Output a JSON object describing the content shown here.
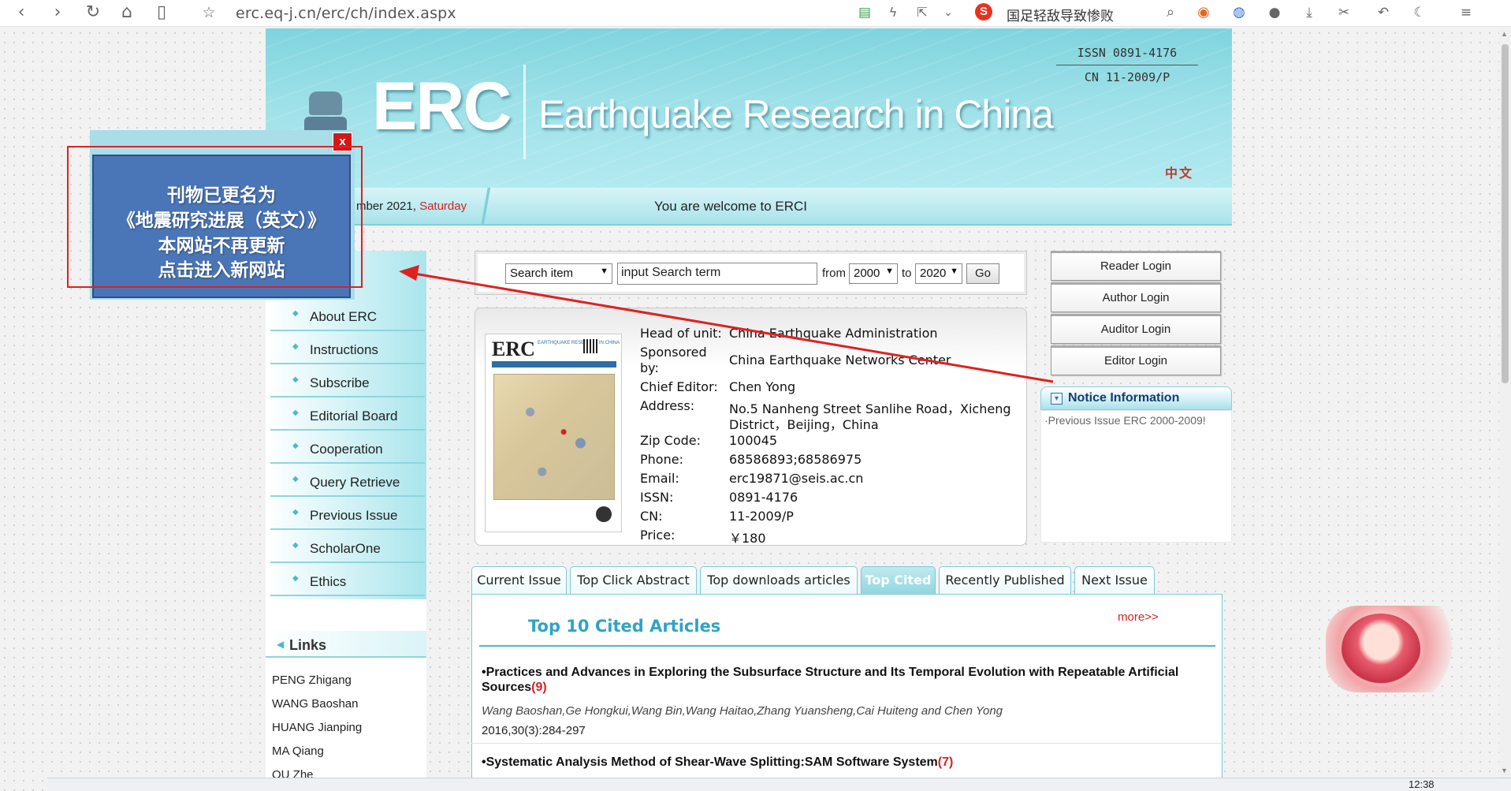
{
  "browser": {
    "url": "erc.eq-j.cn/erc/ch/index.aspx",
    "search_suggestion": "国足轻敌导致惨败",
    "nav_icons": [
      "back-icon",
      "forward-icon",
      "reload-icon",
      "home-icon",
      "reader-icon",
      "star-icon"
    ]
  },
  "header": {
    "logo": "ERC",
    "title": "Earthquake Research in China",
    "issn": "ISSN 0891-4176",
    "cn": "CN 11-2009/P",
    "lang_link": "中文"
  },
  "strip": {
    "date_text": "mber  2021,",
    "day": "Saturday",
    "welcome": "You are welcome to ERCI"
  },
  "popup": {
    "close": "x",
    "lines": [
      "刊物已更名为",
      "《地震研究进展（英文）》",
      "本网站不再更新",
      "点击进入新网站"
    ]
  },
  "search": {
    "field_select": "Search item",
    "input_value": "input Search term",
    "from_label": "from",
    "from_year": "2000",
    "to_label": "to",
    "to_year": "2020",
    "go_label": "Go"
  },
  "nav": {
    "items": [
      "About ERC",
      "Instructions",
      "Subscribe",
      "Editorial Board",
      "Cooperation",
      "Query Retrieve",
      "Previous Issue",
      "ScholarOne",
      "Ethics"
    ],
    "links_title": "Links",
    "links": [
      "PENG Zhigang",
      "WANG Baoshan",
      "HUANG Jianping",
      "MA Qiang",
      "QU Zhe"
    ]
  },
  "journal": {
    "cover_logo": "ERC",
    "cover_subtitle": "EARTHQUAKE RESEARCH IN CHINA",
    "rows": [
      {
        "label": "Head of unit:",
        "value": "China Earthquake Administration"
      },
      {
        "label": "Sponsored",
        "value": "China Earthquake Networks Center"
      },
      {
        "label": "by:",
        "value": ""
      },
      {
        "label": "Chief Editor:",
        "value": "Chen Yong"
      },
      {
        "label": "Address:",
        "value": "No.5 Nanheng Street Sanlihe Road，Xicheng"
      },
      {
        "label": "",
        "value": "District，Beijing，China"
      },
      {
        "label": "Zip Code:",
        "value": "100045"
      },
      {
        "label": "Phone:",
        "value": "68586893;68586975"
      },
      {
        "label": "Email:",
        "value": "erc19871@seis.ac.cn"
      },
      {
        "label": "ISSN:",
        "value": "0891-4176"
      },
      {
        "label": "CN:",
        "value": "11-2009/P"
      },
      {
        "label": "Price:",
        "value": "￥180"
      }
    ]
  },
  "logins": [
    "Reader Login",
    "Author Login",
    "Auditor Login",
    "Editor Login"
  ],
  "notice": {
    "title": "Notice Information",
    "items": [
      "·Previous Issue ERC 2000-2009!"
    ]
  },
  "tabs": [
    "Current Issue",
    "Top Click Abstract",
    "Top downloads articles",
    "Top Cited",
    "Recently Published",
    "Next Issue"
  ],
  "top_cited": {
    "more": "more>>",
    "title": "Top 10 Cited Articles",
    "articles": [
      {
        "title": "•Practices and Advances in Exploring the Subsurface Structure and Its Temporal Evolution with Repeatable Artificial Sources",
        "count": "(9)",
        "authors": "Wang Baoshan,Ge Hongkui,Wang Bin,Wang Haitao,Zhang Yuansheng,Cai Huiteng and Chen Yong",
        "cite": "2016,30(3):284-297"
      },
      {
        "title": "•Systematic Analysis Method of Shear-Wave Splitting:SAM Software System",
        "count": "(7)"
      }
    ]
  },
  "taskbar": {
    "clock": "12:38"
  },
  "colors": {
    "accent": "#2ea4c4",
    "popup": "#4a76b7",
    "alert": "#d51616"
  }
}
